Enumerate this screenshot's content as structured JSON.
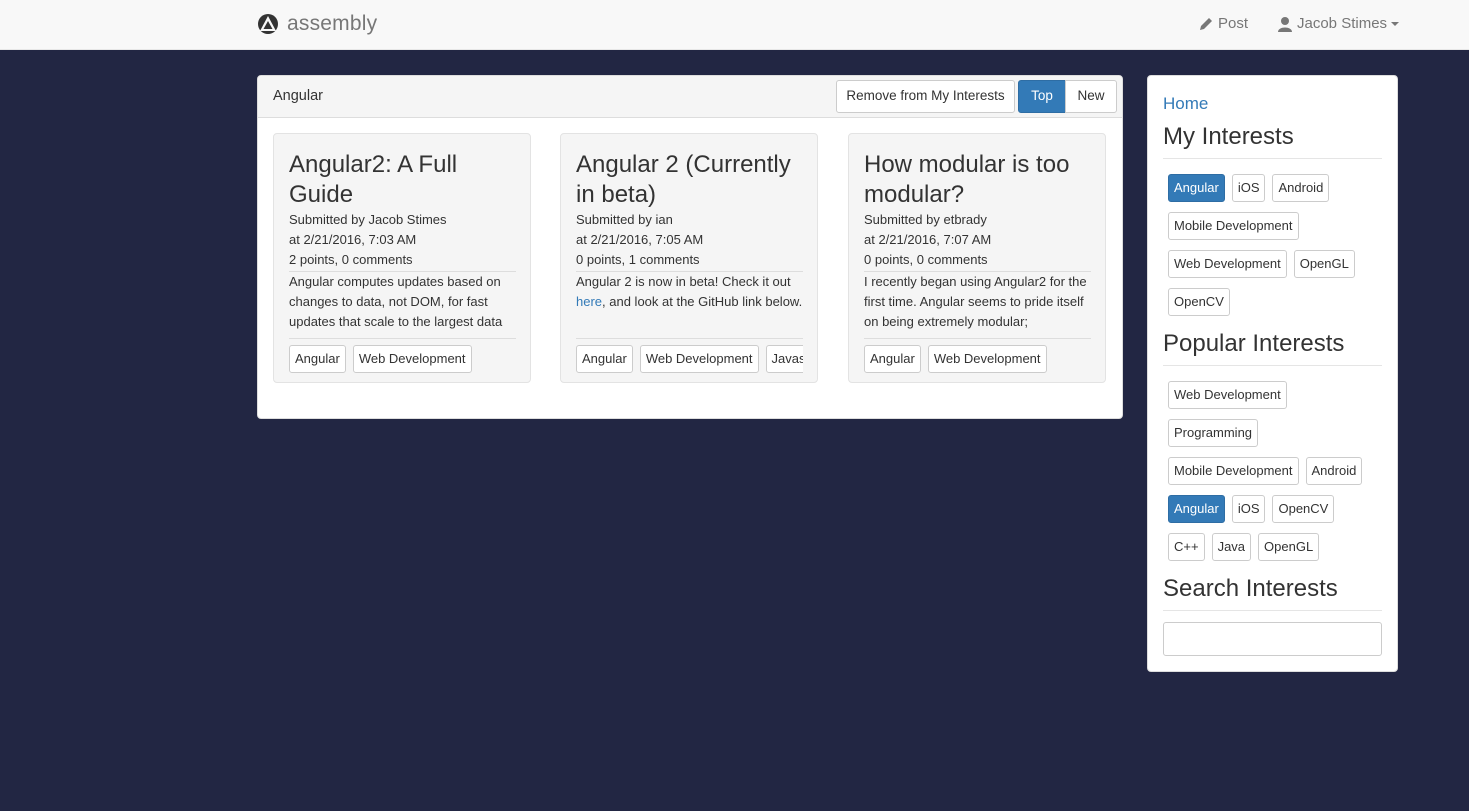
{
  "nav": {
    "brand": "assembly",
    "post_label": "Post",
    "user_name": "Jacob Stimes"
  },
  "panel": {
    "title": "Angular",
    "remove_label": "Remove from My Interests",
    "top_label": "Top",
    "new_label": "New"
  },
  "posts": [
    {
      "title": "Angular2: A Full Guide",
      "submitted": "Submitted by Jacob Stimes",
      "time": "at 2/21/2016, 7:03 AM",
      "stats": "2 points, 0 comments",
      "body": "Angular computes updates based on changes to data, not DOM, for fast updates that scale to the largest data",
      "tags": [
        "Angular",
        "Web Development"
      ]
    },
    {
      "title": "Angular 2 (Currently in beta)",
      "submitted": "Submitted by ian",
      "time": "at 2/21/2016, 7:05 AM",
      "stats": "0 points, 1 comments",
      "body_before": "Angular 2 is now in beta! Check it out ",
      "body_link": "here",
      "body_after": ", and look at the GitHub link below.",
      "tags": [
        "Angular",
        "Web Development",
        "Javascript"
      ]
    },
    {
      "title": "How modular is too modular?",
      "submitted": "Submitted by etbrady",
      "time": "at 2/21/2016, 7:07 AM",
      "stats": "0 points, 0 comments",
      "body": "I recently began using Angular2 for the first time. Angular seems to pride itself on being extremely modular;",
      "tags": [
        "Angular",
        "Web Development"
      ]
    }
  ],
  "sidebar": {
    "home_label": "Home",
    "my_interests_heading": "My Interests",
    "my_interests": [
      "Angular",
      "iOS",
      "Android",
      "Mobile Development",
      "Web Development",
      "OpenGL",
      "OpenCV"
    ],
    "popular_heading": "Popular Interests",
    "popular_interests": [
      "Web Development",
      "Programming",
      "Mobile Development",
      "Android",
      "Angular",
      "iOS",
      "OpenCV",
      "C++",
      "Java",
      "OpenGL"
    ],
    "search_heading": "Search Interests",
    "search_value": ""
  },
  "colors": {
    "background": "#222643",
    "accent": "#337ab7"
  }
}
